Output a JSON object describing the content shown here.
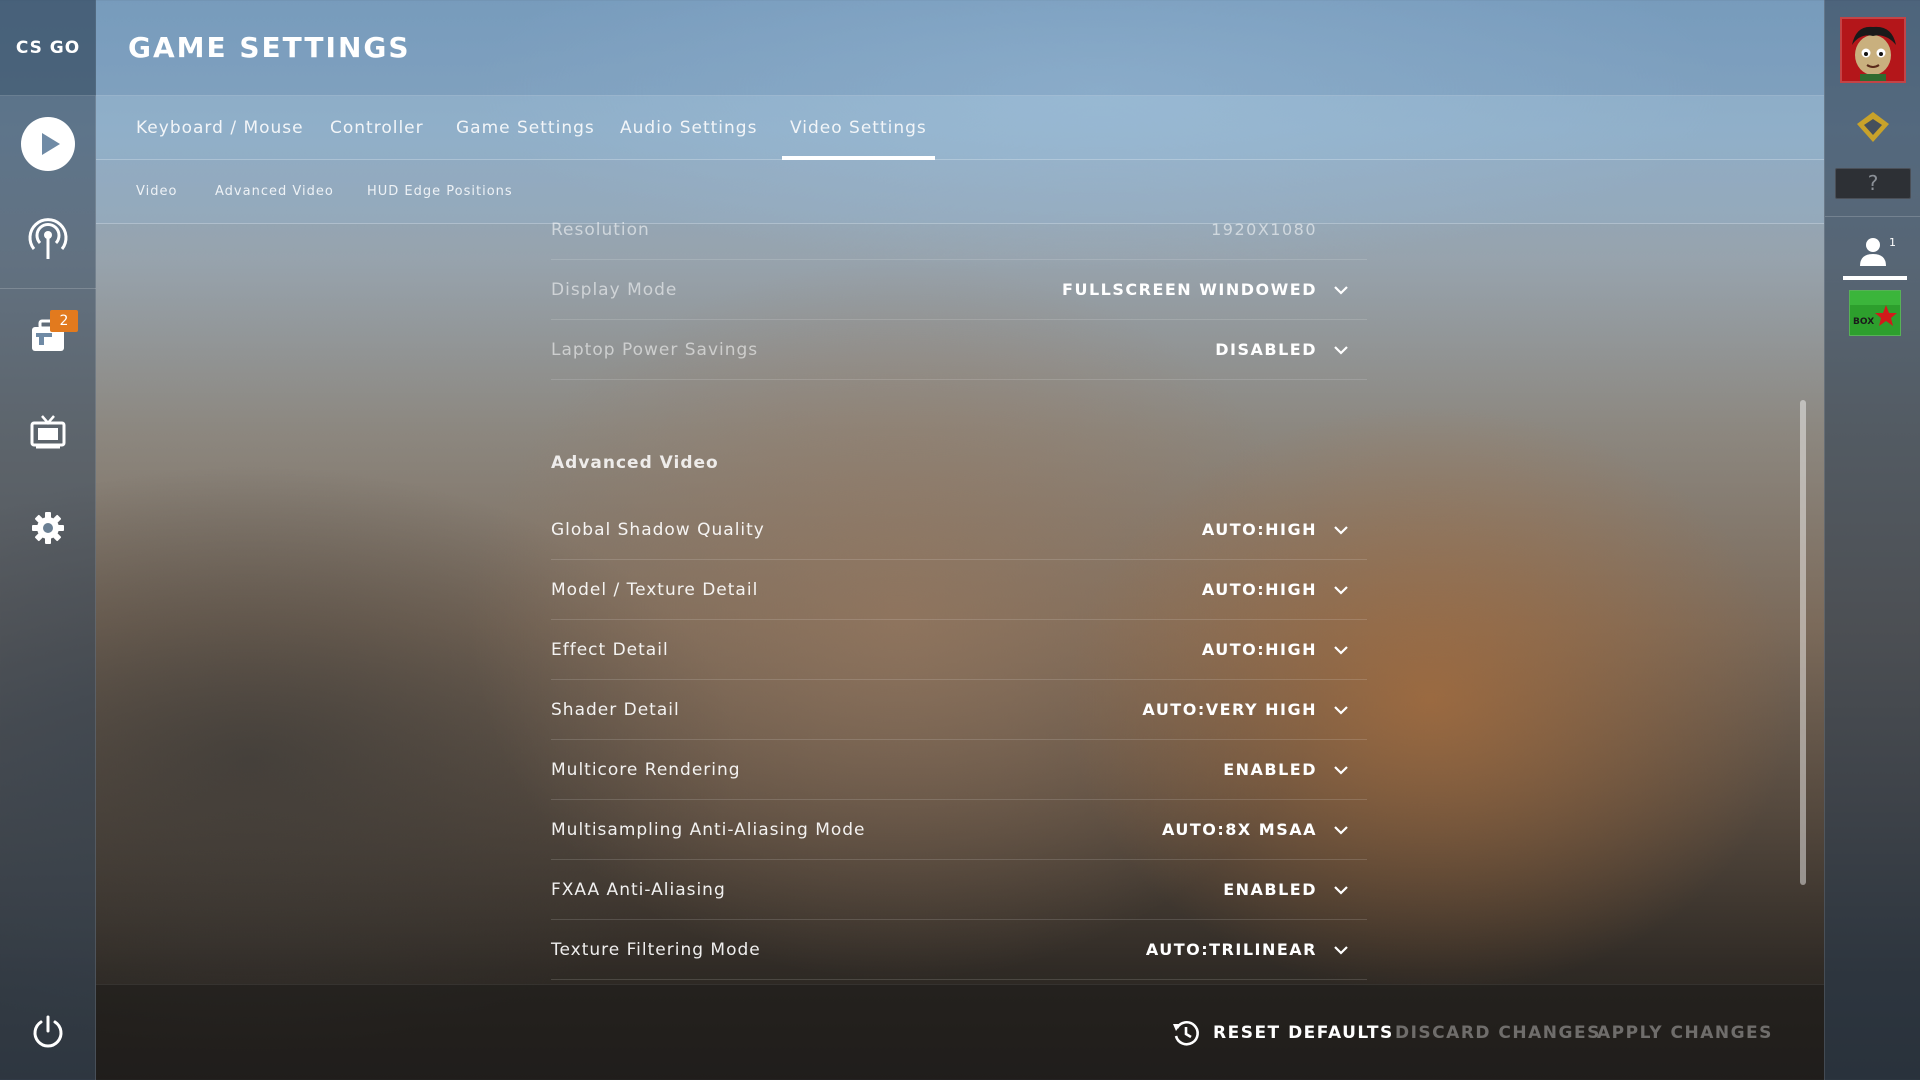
{
  "app": {
    "logo_text": "CS GO",
    "page_title": "GAME SETTINGS"
  },
  "left_nav": {
    "items": [
      {
        "icon": "play-icon"
      },
      {
        "icon": "broadcast-icon"
      },
      {
        "icon": "inventory-icon",
        "badge": "2"
      },
      {
        "icon": "tv-icon"
      },
      {
        "icon": "gear-icon"
      }
    ],
    "power_icon": "power-icon"
  },
  "tabs": [
    {
      "label": "Keyboard / Mouse"
    },
    {
      "label": "Controller"
    },
    {
      "label": "Game Settings"
    },
    {
      "label": "Audio Settings"
    },
    {
      "label": "Video Settings",
      "active": true
    }
  ],
  "subtabs": [
    {
      "label": "Video"
    },
    {
      "label": "Advanced Video"
    },
    {
      "label": "HUD Edge Positions"
    }
  ],
  "video_settings": [
    {
      "label": "Resolution",
      "value": "1920X1080"
    },
    {
      "label": "Display Mode",
      "value": "FULLSCREEN WINDOWED"
    },
    {
      "label": "Laptop Power Savings",
      "value": "DISABLED"
    }
  ],
  "advanced_video": {
    "title": "Advanced Video",
    "settings": [
      {
        "label": "Global Shadow Quality",
        "value": "AUTO:HIGH"
      },
      {
        "label": "Model / Texture Detail",
        "value": "AUTO:HIGH"
      },
      {
        "label": "Effect Detail",
        "value": "AUTO:HIGH"
      },
      {
        "label": "Shader Detail",
        "value": "AUTO:VERY HIGH"
      },
      {
        "label": "Multicore Rendering",
        "value": "ENABLED"
      },
      {
        "label": "Multisampling Anti-Aliasing Mode",
        "value": "AUTO:8X MSAA"
      },
      {
        "label": "FXAA Anti-Aliasing",
        "value": "ENABLED"
      },
      {
        "label": "Texture Filtering Mode",
        "value": "AUTO:TRILINEAR"
      }
    ]
  },
  "footer": {
    "reset_label": "RESET DEFAULTS",
    "discard_label": "DISCARD CHANGES",
    "apply_label": "APPLY CHANGES"
  },
  "right_rail": {
    "rank_unknown": "?",
    "friends_count": "1",
    "friend_avatar_text": "BOX"
  },
  "colors": {
    "badge": "#e27a1e",
    "avatar_bg": "#b4161a",
    "friend_avatar_bg": "#2d9f2d"
  }
}
